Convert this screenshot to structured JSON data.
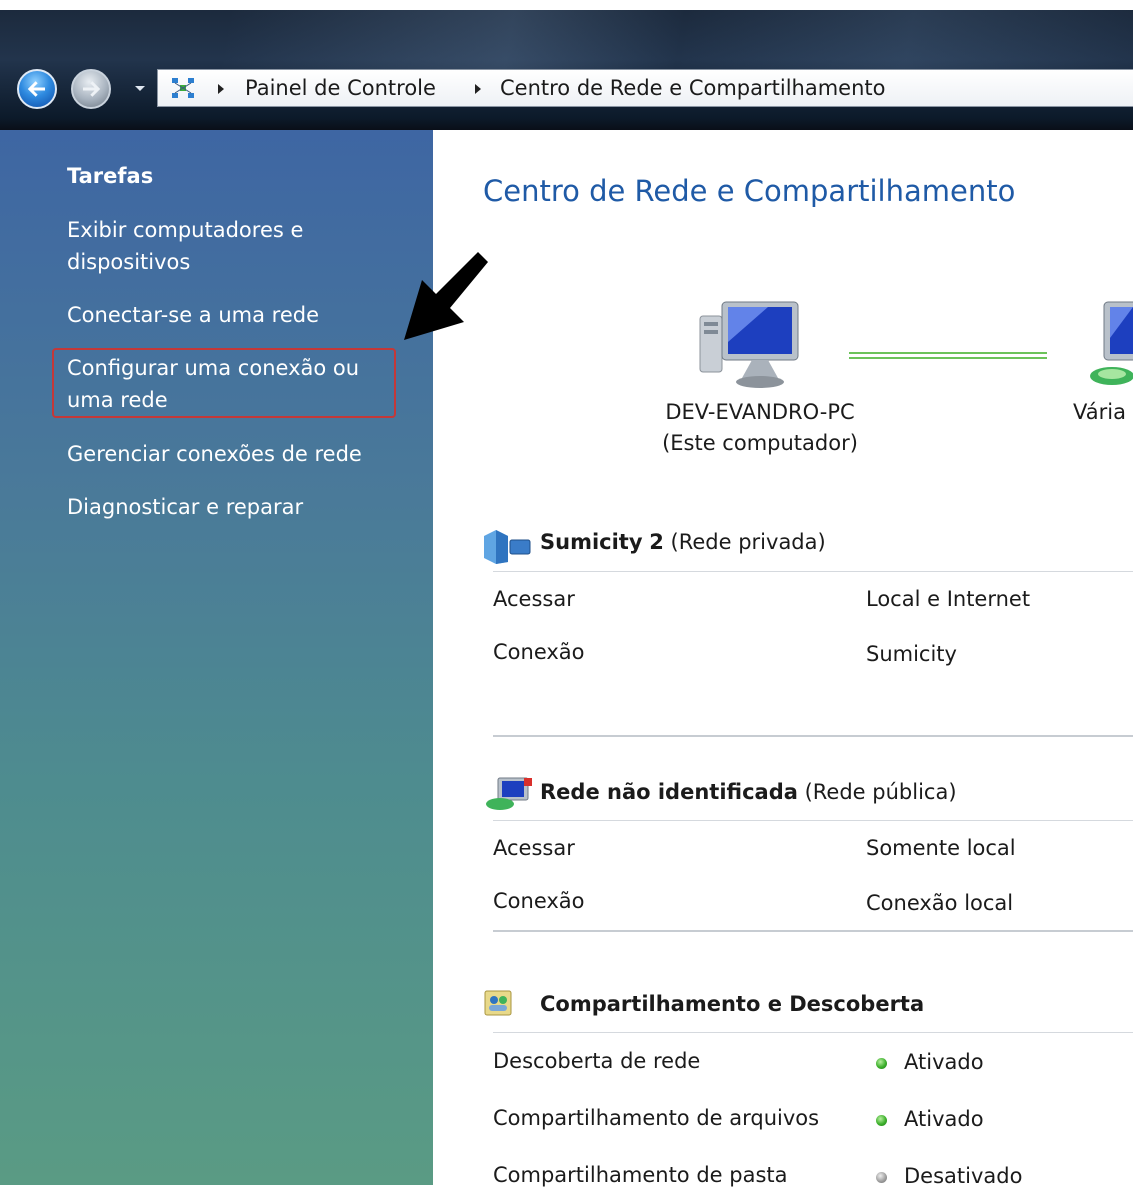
{
  "breadcrumb": {
    "items": [
      "Painel de Controle",
      "Centro de Rede e Compartilhamento"
    ]
  },
  "tasks": {
    "heading": "Tarefas",
    "links": [
      "Exibir computadores e dispositivos",
      "Conectar-se a uma rede",
      "Configurar uma conexão ou uma rede",
      "Gerenciar conexões de rede",
      "Diagnosticar e reparar"
    ]
  },
  "main": {
    "title": "Centro de Rede e Compartilhamento",
    "network_map": {
      "computer_name": "DEV-EVANDRO-PC",
      "computer_note": "(Este computador)",
      "next_node_label": "Vária"
    },
    "networks": [
      {
        "name": "Sumicity",
        "number": "2",
        "type": "(Rede privada)",
        "rows": [
          {
            "label": "Acessar",
            "value": "Local e Internet"
          },
          {
            "label": "Conexão",
            "value": "Sumicity"
          }
        ]
      },
      {
        "name": "Rede não identificada",
        "type": "(Rede pública)",
        "rows": [
          {
            "label": "Acessar",
            "value": "Somente local"
          },
          {
            "label": "Conexão",
            "value": "Conexão local"
          }
        ]
      }
    ],
    "sharing": {
      "title": "Compartilhamento e Descoberta",
      "rows": [
        {
          "label": "Descoberta de rede",
          "value": "Ativado",
          "status": "on"
        },
        {
          "label": "Compartilhamento de arquivos",
          "value": "Ativado",
          "status": "on"
        },
        {
          "label": "Compartilhamento de pasta",
          "value": "Desativado",
          "status": "off"
        }
      ]
    }
  },
  "colors": {
    "title_blue": "#1f5aa6",
    "highlight_red": "#c43838",
    "status_on": "#3db02c",
    "status_off": "#9a9a9a"
  },
  "icons": [
    "back-arrow-icon",
    "forward-arrow-icon",
    "chevron-down-icon",
    "network-folder-icon",
    "breadcrumb-arrow-icon",
    "computer-icon",
    "network-icon",
    "private-network-icon",
    "public-network-icon",
    "sharing-icon",
    "status-dot-icon"
  ]
}
